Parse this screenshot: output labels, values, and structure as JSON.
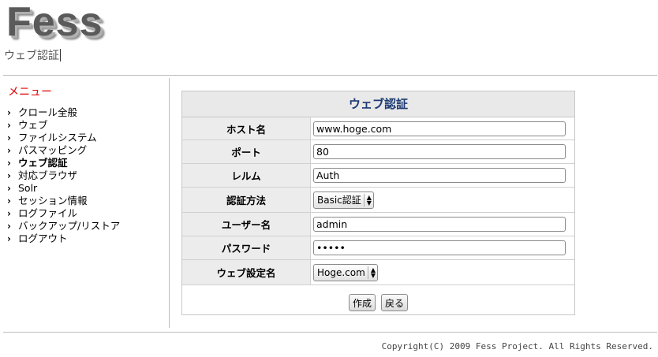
{
  "header": {
    "logo": "Fess",
    "subtitle": "ウェブ認証"
  },
  "menu": {
    "title": "メニュー",
    "items": [
      {
        "label": "クロール全般",
        "active": false
      },
      {
        "label": "ウェブ",
        "active": false
      },
      {
        "label": "ファイルシステム",
        "active": false
      },
      {
        "label": "パスマッピング",
        "active": false
      },
      {
        "label": "ウェブ認証",
        "active": true
      },
      {
        "label": "対応ブラウザ",
        "active": false
      },
      {
        "label": "Solr",
        "active": false
      },
      {
        "label": "セッション情報",
        "active": false
      },
      {
        "label": "ログファイル",
        "active": false
      },
      {
        "label": "バックアップ/リストア",
        "active": false
      },
      {
        "label": "ログアウト",
        "active": false
      }
    ]
  },
  "form": {
    "title": "ウェブ認証",
    "host_label": "ホスト名",
    "host_value": "www.hoge.com",
    "port_label": "ポート",
    "port_value": "80",
    "realm_label": "レルム",
    "realm_value": "Auth",
    "auth_method_label": "認証方法",
    "auth_method_value": "Basic認証",
    "username_label": "ユーザー名",
    "username_value": "admin",
    "password_label": "パスワード",
    "password_value": "•••••",
    "config_label": "ウェブ設定名",
    "config_value": "Hoge.com",
    "create_button": "作成",
    "back_button": "戻る"
  },
  "footer": {
    "copyright": "Copyright(C) 2009 Fess Project. All Rights Reserved."
  }
}
